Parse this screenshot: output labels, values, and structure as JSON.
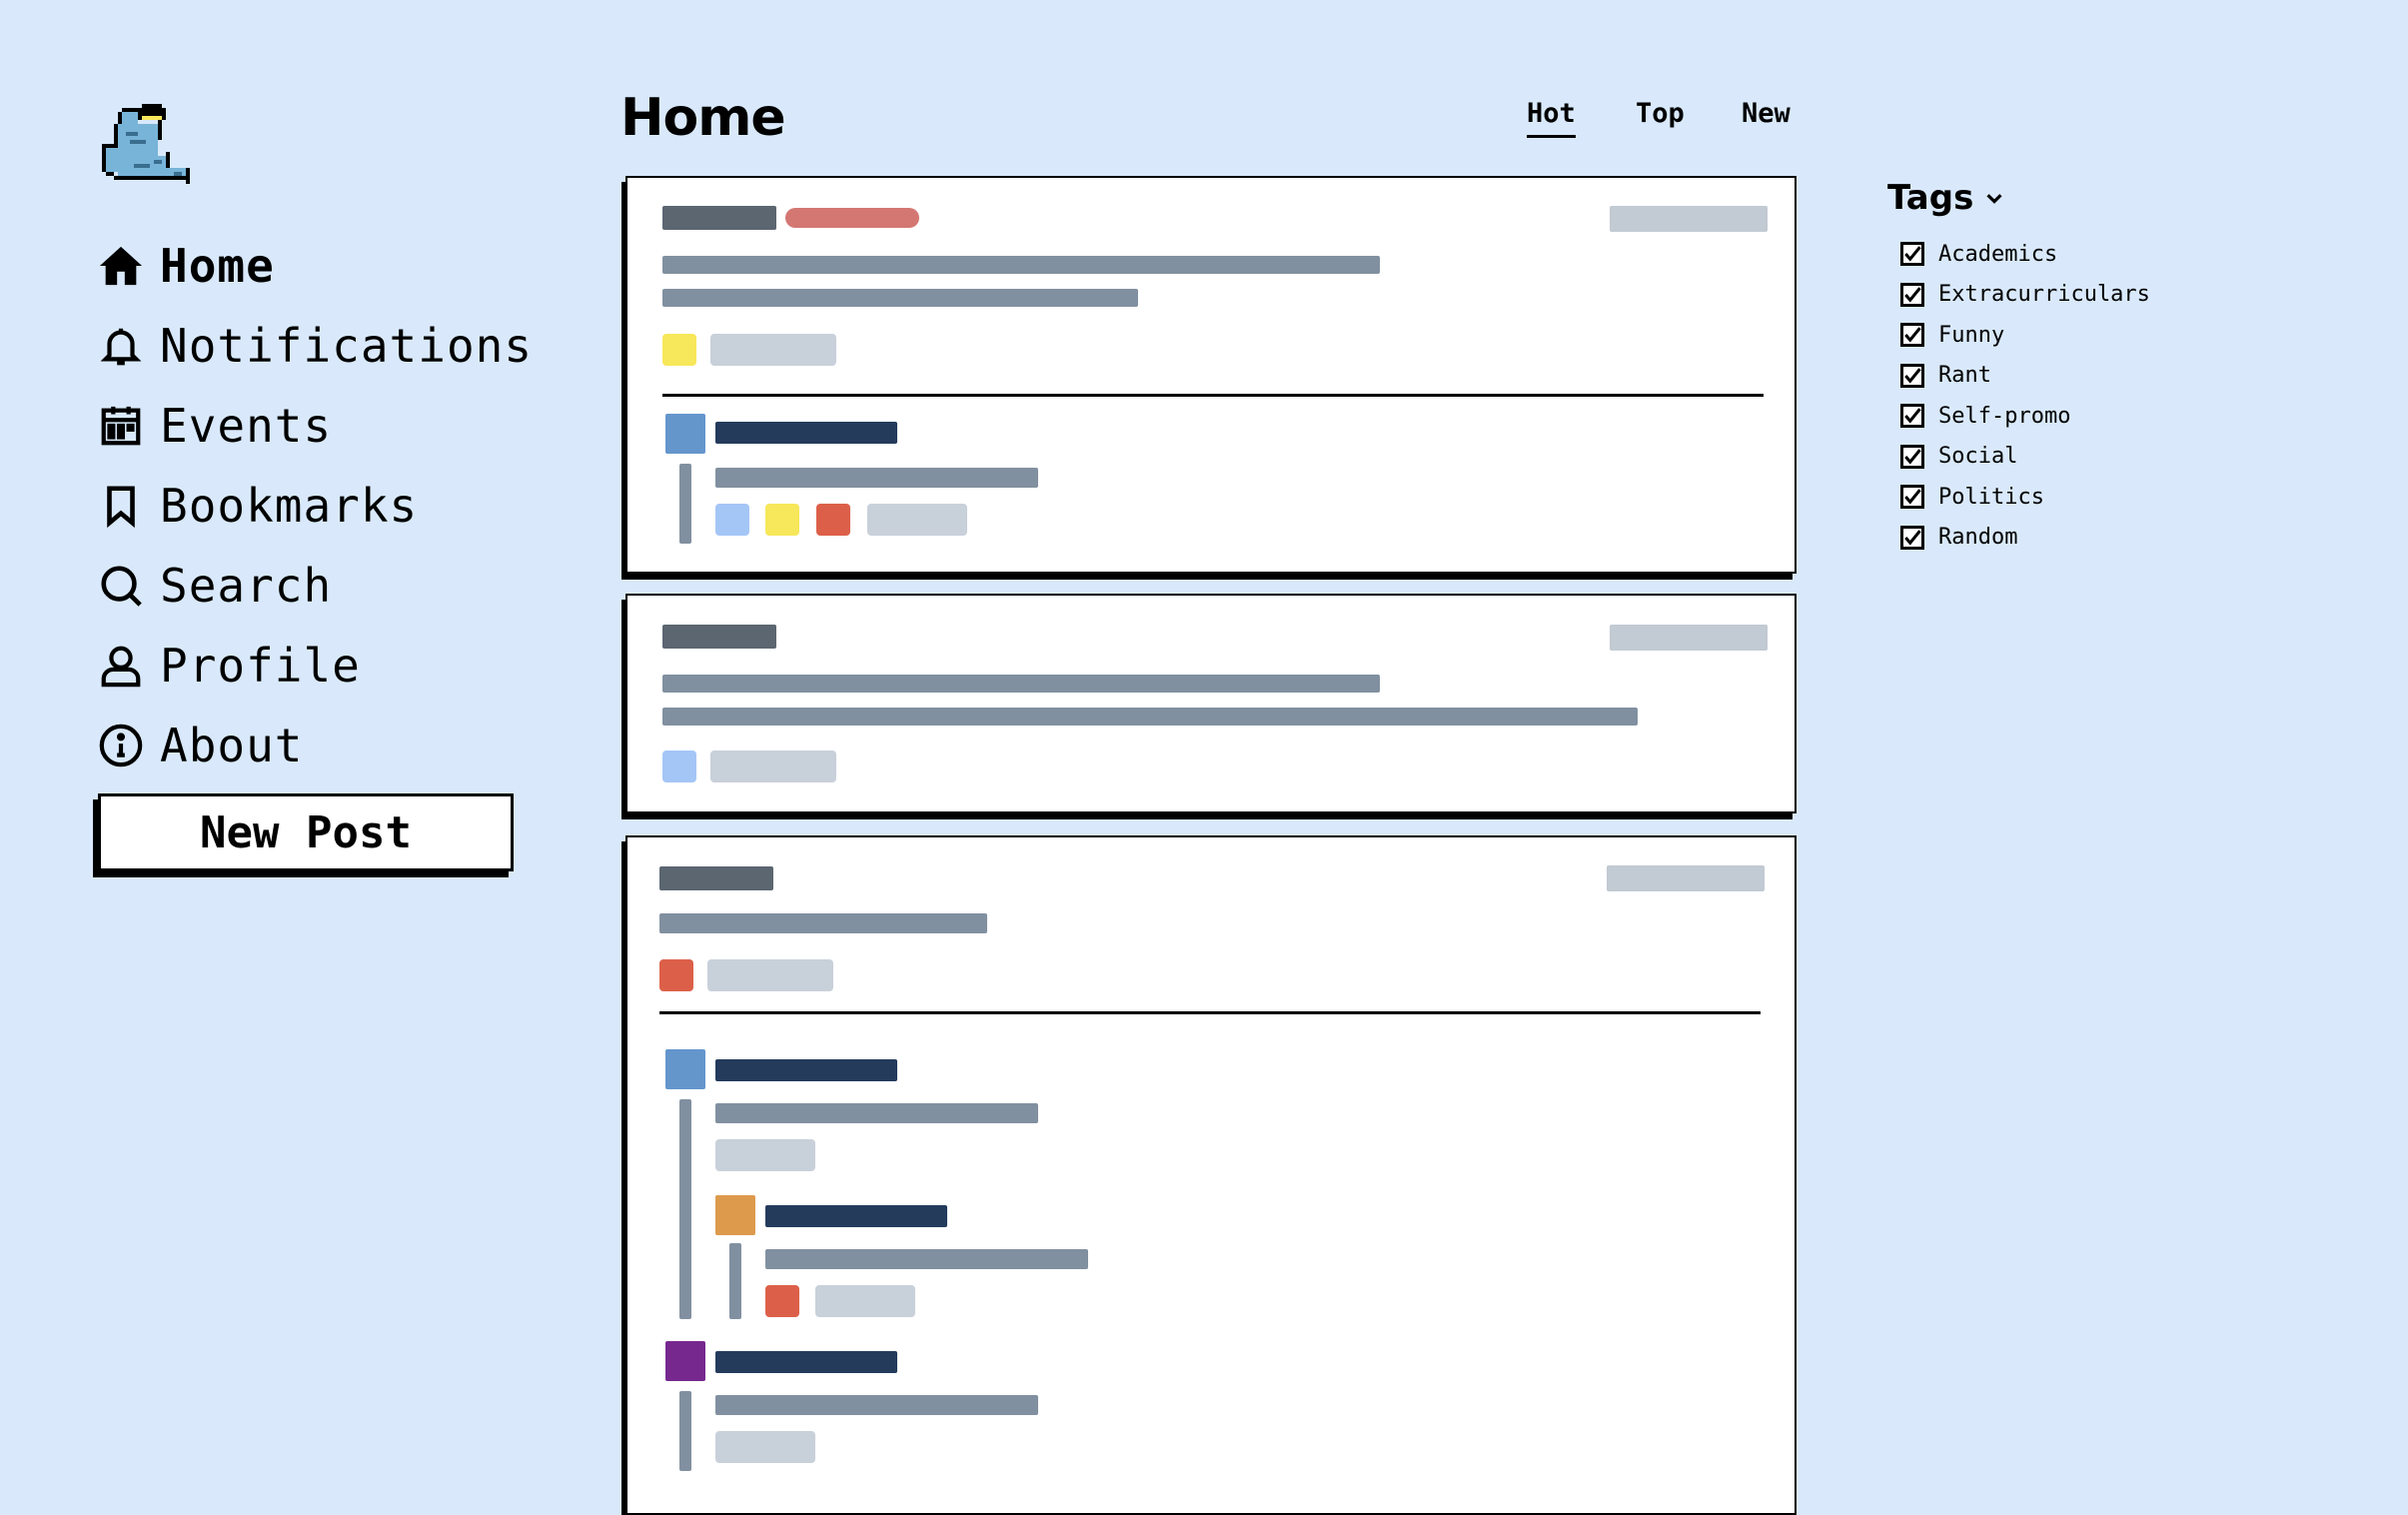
{
  "nav": {
    "items": [
      {
        "label": "Home",
        "icon": "home-icon"
      },
      {
        "label": "Notifications",
        "icon": "bell-icon"
      },
      {
        "label": "Events",
        "icon": "calendar-icon"
      },
      {
        "label": "Bookmarks",
        "icon": "bookmark-icon"
      },
      {
        "label": "Search",
        "icon": "search-icon"
      },
      {
        "label": "Profile",
        "icon": "user-icon"
      },
      {
        "label": "About",
        "icon": "info-icon"
      }
    ],
    "new_post_label": "New Post"
  },
  "header": {
    "title": "Home",
    "sort_tabs": [
      "Hot",
      "Top",
      "New"
    ],
    "active_sort": "Hot"
  },
  "tags": {
    "heading": "Tags",
    "items": [
      {
        "label": "Academics",
        "checked": true
      },
      {
        "label": "Extracurriculars",
        "checked": true
      },
      {
        "label": "Funny",
        "checked": true
      },
      {
        "label": "Rant",
        "checked": true
      },
      {
        "label": "Self-promo",
        "checked": true
      },
      {
        "label": "Social",
        "checked": true
      },
      {
        "label": "Politics",
        "checked": true
      },
      {
        "label": "Random",
        "checked": true
      }
    ]
  },
  "colors": {
    "background": "#d9e9fb",
    "placeholder_dark": "#5b6670",
    "placeholder_mid": "#8190a0",
    "placeholder_light": "#c8d0da",
    "placeholder_navy": "#243b5c",
    "tag_red_pill": "#d47773",
    "tag_yellow": "#f7e75a",
    "tag_blue_light": "#a4c6f6",
    "tag_red": "#dc6049",
    "avatar_blue": "#6496cc",
    "avatar_orange": "#dd9a4d",
    "avatar_purple": "#76288f"
  }
}
